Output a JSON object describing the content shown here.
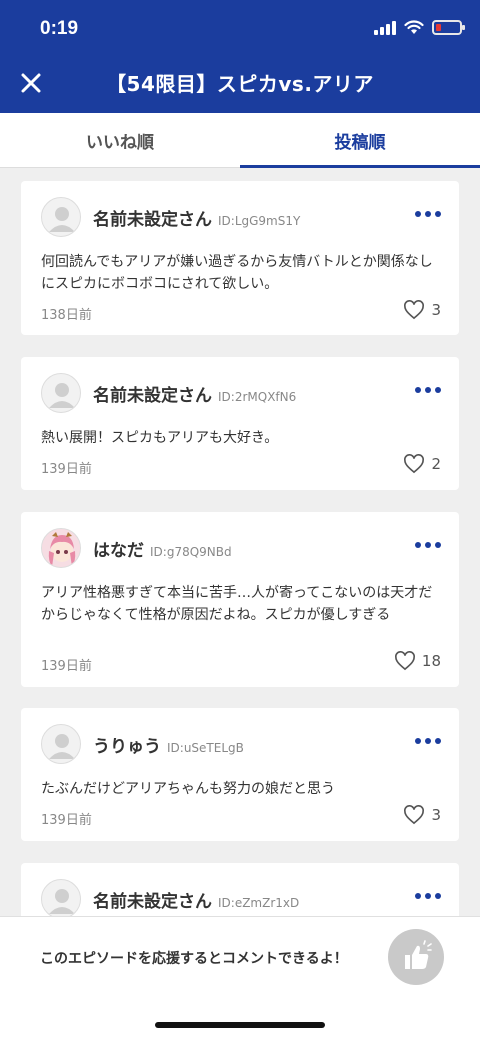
{
  "status_bar": {
    "time": "0:19"
  },
  "header": {
    "title": "【54限目】スピカvs.アリア"
  },
  "tabs": [
    {
      "label": "いいね順",
      "active": false
    },
    {
      "label": "投稿順",
      "active": true
    }
  ],
  "comments": [
    {
      "username": "名前未設定さん",
      "user_id": "ID:LgG9mS1Y",
      "text": "何回読んでもアリアが嫌い過ぎるから友情バトルとか関係なしにスピカにボコボコにされて欲しい。",
      "date": "138日前",
      "likes": "3",
      "avatar": "default"
    },
    {
      "username": "名前未設定さん",
      "user_id": "ID:2rMQXfN6",
      "text": "熱い展開！スピカもアリアも大好き。",
      "date": "139日前",
      "likes": "2",
      "avatar": "default"
    },
    {
      "username": "はなだ",
      "user_id": "ID:g78Q9NBd",
      "text": "アリア性格悪すぎて本当に苦手…人が寄ってこないのは天才だからじゃなくて性格が原因だよね。スピカが優しすぎる",
      "date": "139日前",
      "likes": "18",
      "avatar": "custom"
    },
    {
      "username": "うりゅう",
      "user_id": "ID:uSeTELgB",
      "text": "たぶんだけどアリアちゃんも努力の娘だと思う",
      "date": "139日前",
      "likes": "3",
      "avatar": "default"
    },
    {
      "username": "名前未設定さん",
      "user_id": "ID:eZmZr1xD",
      "text": "",
      "date": "",
      "likes": "",
      "avatar": "default"
    }
  ],
  "footer": {
    "message": "このエピソードを応援するとコメントできるよ！"
  },
  "colors": {
    "brand": "#1b3d9e",
    "battery_low": "#e53935"
  },
  "icons": [
    "close-icon",
    "heart-icon",
    "more-icon",
    "thumbs-up-icon",
    "wifi-icon",
    "battery-icon",
    "signal-icon"
  ]
}
